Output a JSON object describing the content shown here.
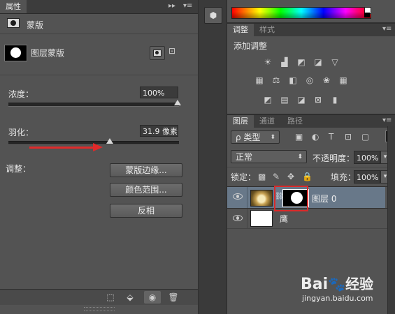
{
  "properties_panel": {
    "tab_label": "属性",
    "mask_header": "蒙版",
    "layer_mask_label": "图层蒙版",
    "density": {
      "label": "浓度：",
      "value": "100%",
      "slider_fraction": 1.0
    },
    "feather": {
      "label": "羽化：",
      "value": "31.9 像素",
      "slider_fraction": 0.595
    },
    "refine_label": "调整：",
    "buttons": {
      "mask_edge": "蒙版边缘...",
      "color_range": "颜色范围...",
      "invert": "反相"
    },
    "bottom_icons": [
      "load-selection-icon",
      "apply-mask-icon",
      "visibility-icon",
      "delete-icon"
    ]
  },
  "toolbar_strip": {
    "icon": "3d-cube-icon"
  },
  "adjustments_panel": {
    "tabs": [
      "调整",
      "样式"
    ],
    "title": "添加调整",
    "icons": [
      "brightness-icon",
      "levels-icon",
      "curves-icon",
      "exposure-icon",
      "vibrance-icon",
      "hue-icon",
      "balance-icon",
      "bw-icon",
      "photo-filter-icon",
      "channel-mixer-icon",
      "lookup-icon",
      "invert-icon",
      "posterize-icon",
      "threshold-icon",
      "selective-color-icon",
      "gradient-map-icon"
    ]
  },
  "layers_panel": {
    "tabs": [
      "图层",
      "通道",
      "路径"
    ],
    "filter_label": "ρ 类型",
    "blend_mode": "正常",
    "opacity_label": "不透明度：",
    "opacity_value": "100%",
    "lock_label": "锁定：",
    "fill_label": "填充：",
    "fill_value": "100%",
    "layers": [
      {
        "name": "图层 0",
        "selected": true,
        "has_mask": true
      },
      {
        "name": "鹰",
        "selected": false,
        "has_mask": false
      }
    ]
  },
  "watermark": {
    "brand": "Bai",
    "brand_mid": "经验",
    "url": "jingyan.baidu.com"
  },
  "colors": {
    "panel_bg": "#535353",
    "tab_bg": "#3c3c3c",
    "selected_layer": "#6a7a8c",
    "arrow_red": "#e02a2a"
  }
}
